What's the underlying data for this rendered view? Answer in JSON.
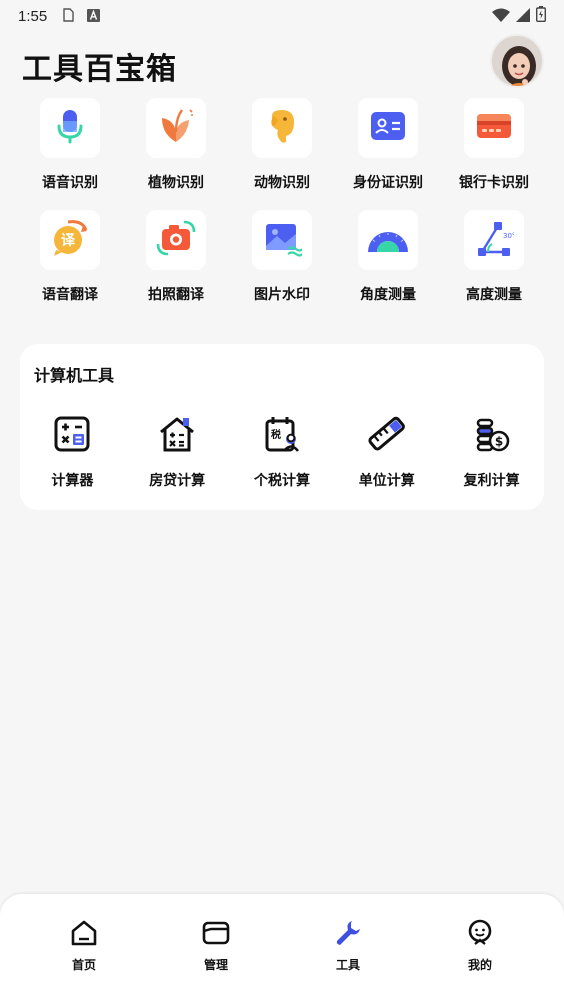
{
  "status_bar": {
    "time": "1:55",
    "icons": [
      "sim-card-icon",
      "font-a-icon",
      "wifi-icon",
      "signal-icon",
      "battery-icon"
    ]
  },
  "header": {
    "title": "工具百宝箱",
    "avatar": "avatar"
  },
  "tools": [
    {
      "label": "语音识别",
      "icon": "microphone-icon"
    },
    {
      "label": "植物识别",
      "icon": "leaf-icon"
    },
    {
      "label": "动物识别",
      "icon": "elephant-icon"
    },
    {
      "label": "身份证识别",
      "icon": "id-card-icon"
    },
    {
      "label": "银行卡识别",
      "icon": "bank-card-icon"
    },
    {
      "label": "语音翻译",
      "icon": "translate-icon"
    },
    {
      "label": "拍照翻译",
      "icon": "camera-icon"
    },
    {
      "label": "图片水印",
      "icon": "image-icon"
    },
    {
      "label": "角度测量",
      "icon": "protractor-icon"
    },
    {
      "label": "高度测量",
      "icon": "height-measure-icon"
    }
  ],
  "calculator_section": {
    "title": "计算机工具",
    "items": [
      {
        "label": "计算器",
        "icon": "calculator-icon"
      },
      {
        "label": "房贷计算",
        "icon": "house-calc-icon"
      },
      {
        "label": "个税计算",
        "icon": "tax-icon"
      },
      {
        "label": "单位计算",
        "icon": "ruler-icon"
      },
      {
        "label": "复利计算",
        "icon": "coins-icon"
      }
    ]
  },
  "bottom_nav": [
    {
      "label": "首页",
      "icon": "home-icon",
      "active": false
    },
    {
      "label": "管理",
      "icon": "folder-icon",
      "active": false
    },
    {
      "label": "工具",
      "icon": "wrench-icon",
      "active": true
    },
    {
      "label": "我的",
      "icon": "profile-icon",
      "active": false
    }
  ],
  "colors": {
    "accent": "#3f4fe0",
    "orange": "#f07a3e",
    "mint": "#37d6a8",
    "background": "#f6f6f6"
  }
}
